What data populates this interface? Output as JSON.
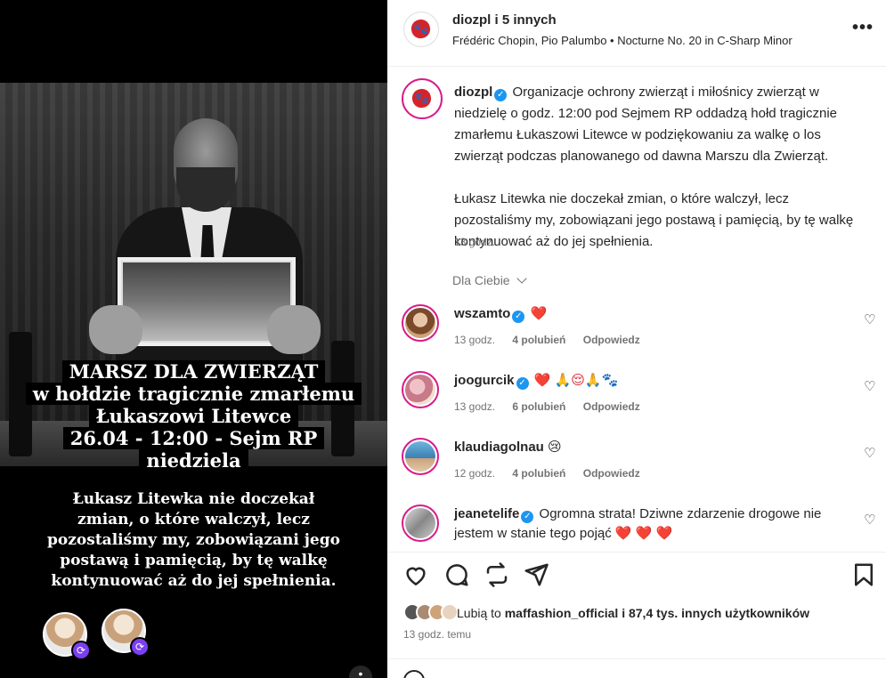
{
  "media": {
    "banner_lines": [
      "MARSZ DLA ZWIERZĄT",
      "w hołdzie tragicznie zmarłemu",
      "Łukaszowi Litewce",
      "26.04 - 12:00 - Sejm RP",
      "niedziela"
    ],
    "body_lines": [
      "Łukasz Litewka nie doczekał",
      "zmian, o które walczył, lecz",
      "pozostaliśmy my, zobowiązani jego",
      "postawą i pamięcią, by tę walkę",
      "kontynuować aż do jej spełnienia."
    ],
    "tag_icon": "repost-icon"
  },
  "header": {
    "account": "diozpl",
    "others": "i 5 innych",
    "audio": "Frédéric Chopin, Pio Palumbo • Nocturne No. 20 in C-Sharp Minor",
    "more": "•••"
  },
  "caption": {
    "account": "diozpl",
    "paragraph1": "Organizacje ochrony zwierząt i miłośnicy zwierząt w niedzielę o godz. 12:00 pod Sejmem RP oddadzą hołd tragicznie zmarłemu Łukaszowi Litewce w podziękowaniu za walkę o los zwierząt podczas planowanego od dawna Marszu dla Zwierząt.",
    "paragraph2": "Łukasz Litewka nie doczekał zmian, o które walczył, lecz pozostaliśmy my, zobowiązani jego postawą i pamięcią, by tę walkę kontynuować aż do jej spełnienia.",
    "time": "13 godz."
  },
  "filter": {
    "label": "Dla Ciebie"
  },
  "comments": [
    {
      "user": "wszamto",
      "verified": true,
      "text": "❤️",
      "time": "13 godz.",
      "likes": "4 polubień",
      "reply": "Odpowiedz"
    },
    {
      "user": "joogurcik",
      "verified": true,
      "text": "❤️ 🙏😌🙏🐾",
      "time": "13 godz.",
      "likes": "6 polubień",
      "reply": "Odpowiedz"
    },
    {
      "user": "klaudiagolnau",
      "verified": false,
      "text": "😢",
      "time": "12 godz.",
      "likes": "4 polubień",
      "reply": "Odpowiedz"
    },
    {
      "user": "jeanetelife",
      "verified": true,
      "text": "Ogromna strata! Dziwne zdarzenie drogowe nie jestem w stanie tego pojąć ❤️ ❤️ ❤️",
      "time": "",
      "likes": "",
      "reply": ""
    }
  ],
  "actions": {
    "like_icon": "heart-outline-icon",
    "comment_icon": "comment-icon",
    "repost_icon": "repost-icon",
    "share_icon": "send-icon",
    "save_icon": "bookmark-icon"
  },
  "likes": {
    "prefix": "Lubią to",
    "user": "maffashion_official",
    "suffix": "i 87,4 tys. innych użytkowników"
  },
  "post_time": "13 godz. temu",
  "colors": {
    "accent": "#d6232a",
    "verified": "#1c96f0",
    "muted": "#737373",
    "heart": "#d92233"
  }
}
